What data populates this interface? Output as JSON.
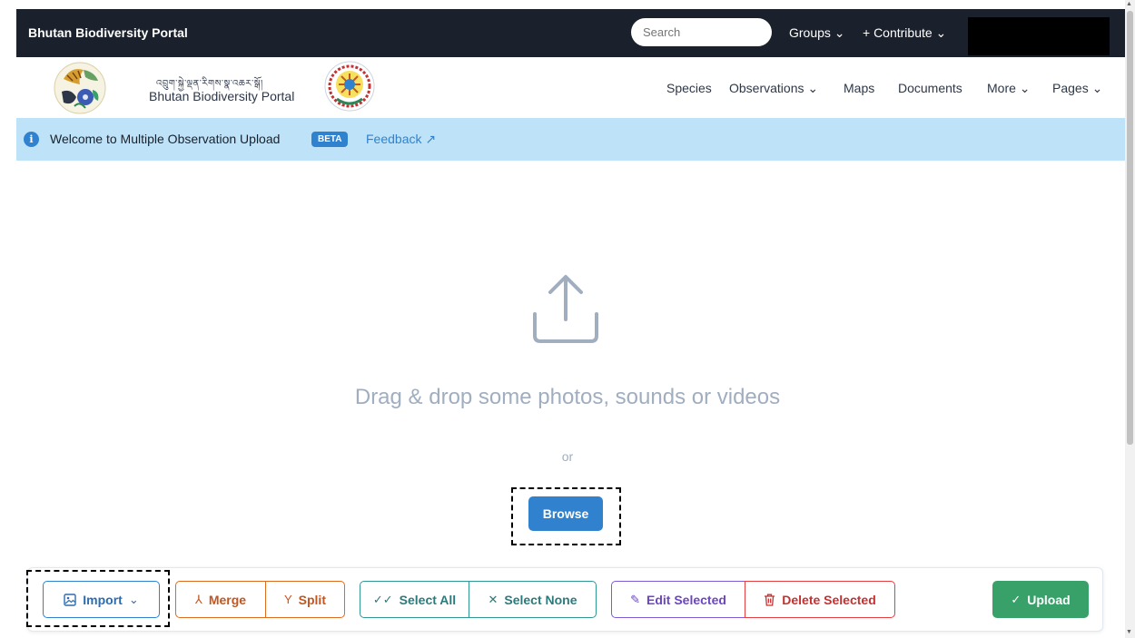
{
  "topbar": {
    "brand": "Bhutan Biodiversity Portal",
    "search_placeholder": "Search",
    "groups": "Groups ⌄",
    "contribute": "+ Contribute ⌄"
  },
  "header": {
    "portal_subtitle": "འབྲུག་སྐྱེ་ལྡན་རིགས་སྣ་འཆར་སྒོ།",
    "portal_name": "Bhutan Biodiversity Portal",
    "nav": {
      "species": "Species",
      "observations": "Observations ⌄",
      "maps": "Maps",
      "documents": "Documents",
      "more": "More ⌄",
      "pages": "Pages ⌄"
    }
  },
  "banner": {
    "welcome": "Welcome to Multiple Observation Upload",
    "badge": "BETA",
    "feedback": "Feedback ↗"
  },
  "dropzone": {
    "drag_text": "Drag & drop some photos, sounds or videos",
    "or": "or",
    "browse": "Browse"
  },
  "toolbar": {
    "import": "Import",
    "merge": "Merge",
    "split": "Split",
    "select_all": "Select All",
    "select_none": "Select None",
    "edit_selected": "Edit Selected",
    "delete_selected": "Delete Selected",
    "upload": "Upload"
  },
  "colors": {
    "topbar_bg": "#1a202c",
    "banner_bg": "#bee3f8",
    "accent_blue": "#3182ce",
    "orange": "#dd6b20",
    "teal": "#319795",
    "purple": "#805ad5",
    "red": "#e53e3e",
    "green": "#38a169"
  }
}
